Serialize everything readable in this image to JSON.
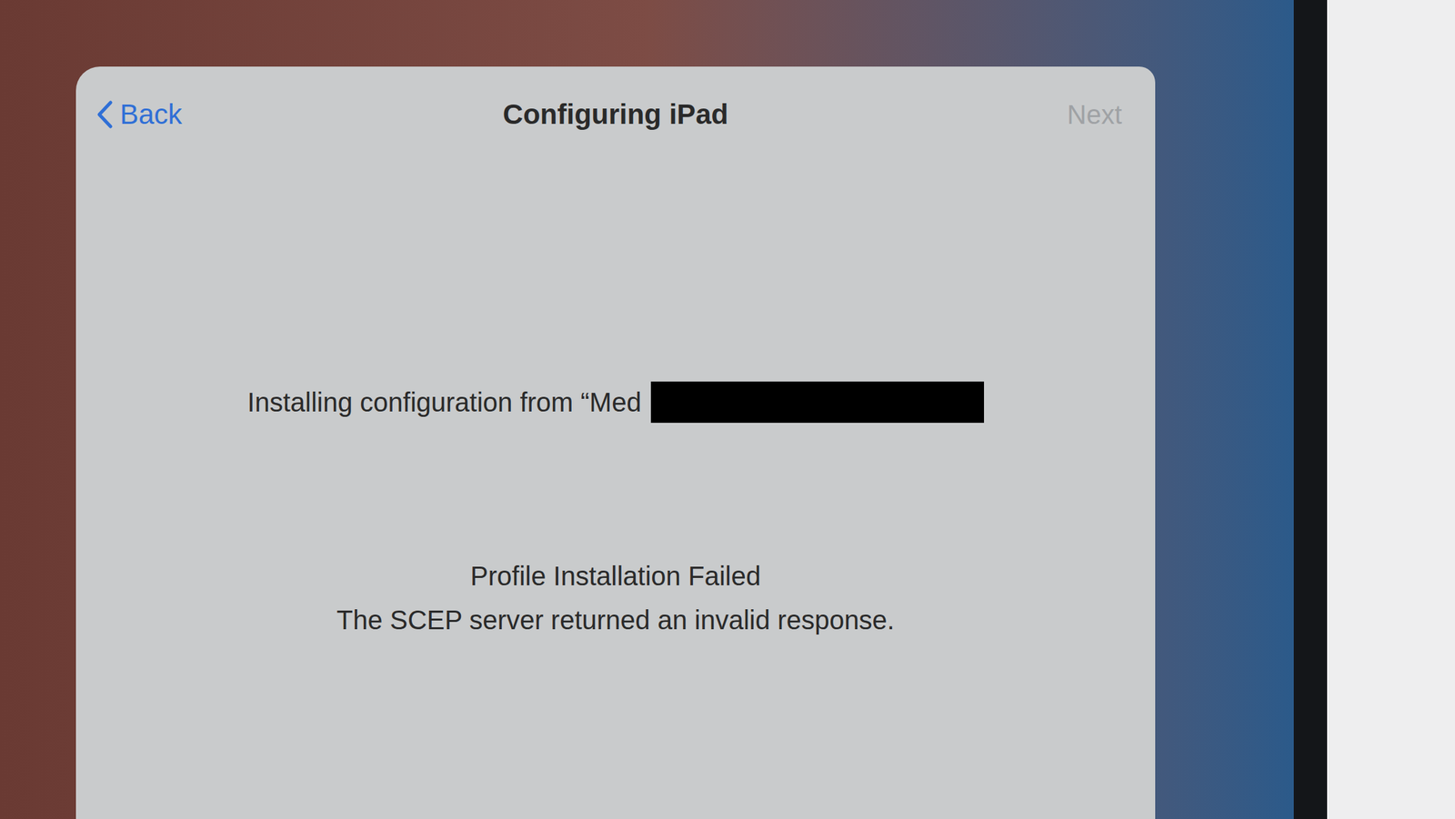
{
  "header": {
    "back": "Back",
    "title": "Configuring iPad",
    "next": {
      "label": "Next",
      "disabled": true
    }
  },
  "status": {
    "installing": "Installing configuration from “Med"
  },
  "error": {
    "title": "Profile Installation Failed",
    "message": "The SCEP server returned an invalid response."
  }
}
